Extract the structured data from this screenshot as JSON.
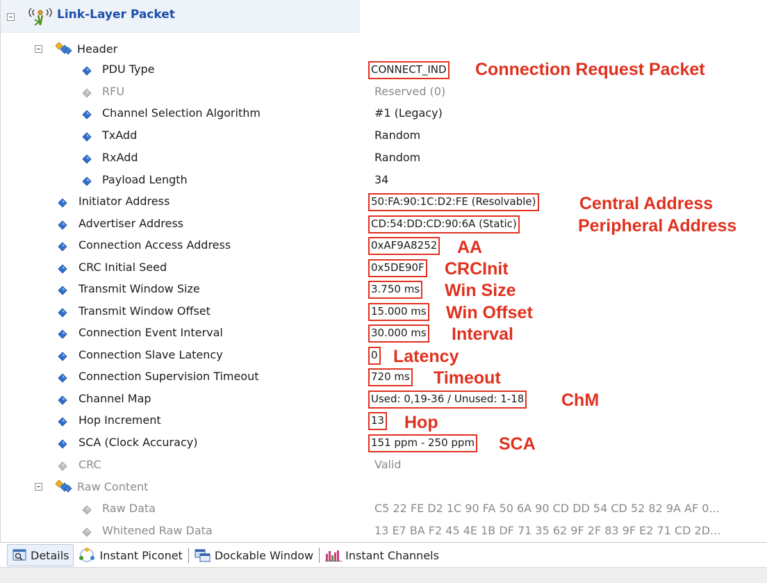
{
  "title": "Link-Layer Packet",
  "header_node": "Header",
  "raw_node": "Raw Content",
  "fields": [
    {
      "label": "PDU Type",
      "value": "CONNECT_IND",
      "annotation": "Connection Request Packet",
      "dim": false,
      "boxed": true
    },
    {
      "label": "RFU",
      "value": "Reserved (0)",
      "annotation": "",
      "dim": true,
      "boxed": false
    },
    {
      "label": "Channel Selection Algorithm",
      "value": "#1 (Legacy)",
      "annotation": "",
      "dim": false,
      "boxed": false
    },
    {
      "label": "TxAdd",
      "value": "Random",
      "annotation": "",
      "dim": false,
      "boxed": false
    },
    {
      "label": "RxAdd",
      "value": "Random",
      "annotation": "",
      "dim": false,
      "boxed": false
    },
    {
      "label": "Payload Length",
      "value": "34",
      "annotation": "",
      "dim": false,
      "boxed": false
    },
    {
      "label": "Initiator Address",
      "value": "50:FA:90:1C:D2:FE (Resolvable)",
      "annotation": "Central Address",
      "dim": false,
      "boxed": true
    },
    {
      "label": "Advertiser Address",
      "value": "CD:54:DD:CD:90:6A (Static)",
      "annotation": "Peripheral Address",
      "dim": false,
      "boxed": true
    },
    {
      "label": "Connection Access Address",
      "value": "0xAF9A8252",
      "annotation": "AA",
      "dim": false,
      "boxed": true
    },
    {
      "label": "CRC Initial Seed",
      "value": "0x5DE90F",
      "annotation": "CRCInit",
      "dim": false,
      "boxed": true
    },
    {
      "label": "Transmit Window Size",
      "value": "3.750 ms",
      "annotation": "Win Size",
      "dim": false,
      "boxed": true
    },
    {
      "label": "Transmit Window Offset",
      "value": "15.000 ms",
      "annotation": "Win Offset",
      "dim": false,
      "boxed": true
    },
    {
      "label": "Connection Event Interval",
      "value": "30.000 ms",
      "annotation": "Interval",
      "dim": false,
      "boxed": true
    },
    {
      "label": "Connection Slave Latency",
      "value": "0",
      "annotation": "Latency",
      "dim": false,
      "boxed": true
    },
    {
      "label": "Connection Supervision Timeout",
      "value": "720 ms",
      "annotation": "Timeout",
      "dim": false,
      "boxed": true
    },
    {
      "label": "Channel Map",
      "value": "Used: 0,19-36 / Unused: 1-18",
      "annotation": "ChM",
      "dim": false,
      "boxed": true
    },
    {
      "label": "Hop Increment",
      "value": "13",
      "annotation": "Hop",
      "dim": false,
      "boxed": true
    },
    {
      "label": "SCA (Clock Accuracy)",
      "value": "151 ppm - 250 ppm",
      "annotation": "SCA",
      "dim": false,
      "boxed": true
    },
    {
      "label": "CRC",
      "value": "Valid",
      "annotation": "",
      "dim": true,
      "boxed": false
    }
  ],
  "raw": [
    {
      "label": "Raw Data",
      "value": "C5 22 FE D2 1C 90 FA 50 6A 90 CD DD 54 CD 52 82 9A AF 0..."
    },
    {
      "label": "Whitened Raw Data",
      "value": "13 E7 BA F2 45 4E 1B DF 71 35 62 9F 2F 83 9F E2 71 CD 2D..."
    }
  ],
  "tabs": [
    {
      "label": "Details",
      "icon": "magnifier-window-icon",
      "active": true
    },
    {
      "label": "Instant Piconet",
      "icon": "piconet-icon",
      "active": false
    },
    {
      "label": "Dockable Window",
      "icon": "dockable-window-icon",
      "active": false
    },
    {
      "label": "Instant Channels",
      "icon": "channels-chart-icon",
      "active": false
    }
  ],
  "colors": {
    "annotation": "#e0301e",
    "title": "#1e4fa8",
    "bullet": "#2f6fd0"
  }
}
